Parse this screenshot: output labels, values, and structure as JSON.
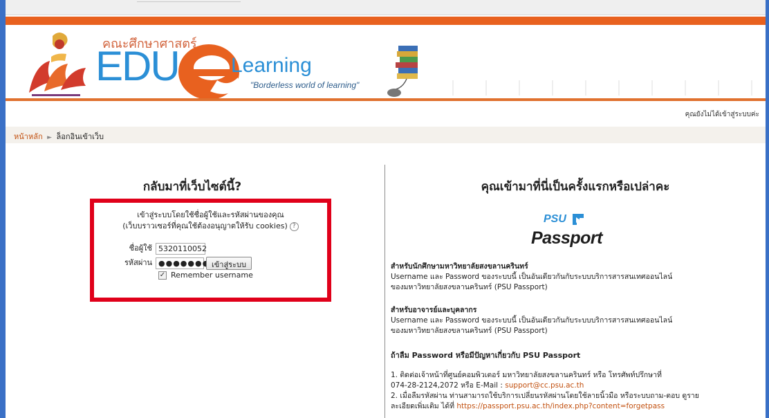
{
  "header": {
    "faculty_title": "คณะศึกษาศาสตร์",
    "logo_edu": "EDU",
    "logo_learning": "Learning",
    "tagline": "\"Borderless world of learning\"",
    "status_text": "คุณยังไม่ได้เข้าสู่ระบบค่ะ"
  },
  "breadcrumb": {
    "home": "หน้าหลัก",
    "separator": "►",
    "current": "ล็อกอินเข้าเว็บ"
  },
  "login": {
    "heading": "กลับมาที่เว็บไซต์นี้?",
    "instruction_line1": "เข้าสู่ระบบโดยใช้ชื่อผู้ใช้และรหัสผ่านของคุณ",
    "instruction_line2": "(เว็บบราวเซอร์ที่คุณใช้ต้องอนุญาตให้รับ cookies)",
    "help_icon": "?",
    "username_label": "ชื่อผู้ใช้",
    "username_value": "5320110052",
    "password_label": "รหัสผ่าน",
    "password_value": "●●●●●●●●●●",
    "login_button": "เข้าสู่ระบบ",
    "remember_checked": "✓",
    "remember_label": "Remember username",
    "highlight_color": "#e0001a"
  },
  "firsttime": {
    "heading": "คุณเข้ามาที่นี่เป็นครั้งแรกหรือเปล่าคะ",
    "logo_small": "PSU",
    "logo_big": "Passport",
    "students_title": "สำหรับนักศึกษามหาวิทยาลัยสงขลานครินทร์",
    "students_line1": "Username และ Password ของระบบนี้ เป็นอันเดียวกันกับระบบบริการสารสนเทศออนไลน์",
    "students_line2": "ของมหาวิทยาลัยสงขลานครินทร์ (PSU Passport)",
    "staff_title": "สำหรับอาจารย์และบุคลากร",
    "staff_line1": "Username และ Password ของระบบนี้ เป็นอันเดียวกันกับระบบบริการสารสนเทศออนไลน์",
    "staff_line2": "ของมหาวิทยาลัยสงขลานครินทร์ (PSU Passport)",
    "forgot_title": "ถ้าลืม Password หรือมีปัญหาเกี่ยวกับ PSU Passport",
    "step1_line1": "1. ติดต่อเจ้าหน้าที่ศูนย์คอมพิวเตอร์ มหาวิทยาลัยสงขลานครินทร์ หรือ โทรศัพท์ปรึกษาที่",
    "step1_line2": "074-28-2124,2072 หรือ  E-Mail : ",
    "support_email": "support@cc.psu.ac.th",
    "step2_line1": "2. เมื่อลืมรหัสผ่าน ท่านสามารถใช้บริการเปลี่ยนรหัสผ่านโดยใช้ลายนิ้วมือ หรือระบบถาม-ตอบ ดูราย",
    "step2_line2": "ละเอียดเพิ่มเติม ได้ที่  ",
    "forget_link": "https://passport.psu.ac.th/index.php?content=forgetpass"
  },
  "colors": {
    "frame_blue": "#3a70c6",
    "accent_orange": "#e8611f",
    "logo_blue": "#2b8fd6",
    "link_orange": "#c2500f"
  }
}
